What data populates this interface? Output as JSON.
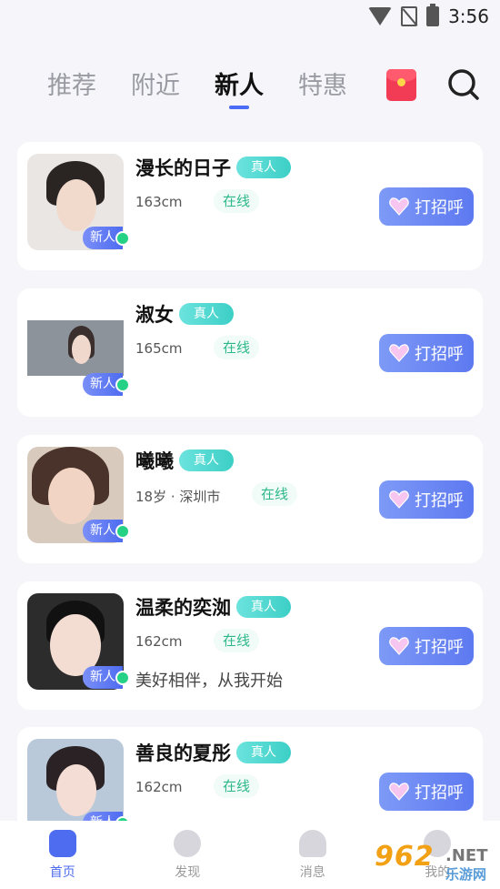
{
  "status_bar": {
    "time": "3:56"
  },
  "top_tabs": [
    {
      "label": "推荐"
    },
    {
      "label": "附近"
    },
    {
      "label": "新人",
      "active": true
    },
    {
      "label": "特惠"
    }
  ],
  "icons": {
    "red_packet": "red-packet-icon",
    "search": "search-icon"
  },
  "colors": {
    "accent": "#4e6cf0",
    "real_badge": "#3ccfc6",
    "online": "#25d184",
    "red_packet": "#f23c56"
  },
  "users": [
    {
      "name": "漫长的日子",
      "real_badge": "真人",
      "info": "163cm",
      "online": "在线",
      "new_badge": "新人",
      "bio": "",
      "greet": "打招呼"
    },
    {
      "name": "淑女",
      "real_badge": "真人",
      "info": "165cm",
      "online": "在线",
      "new_badge": "新人",
      "bio": "",
      "greet": "打招呼"
    },
    {
      "name": "曦曦",
      "real_badge": "真人",
      "info": "18岁 · 深圳市",
      "online": "在线",
      "new_badge": "新人",
      "bio": "",
      "greet": "打招呼"
    },
    {
      "name": "温柔的奕洳",
      "real_badge": "真人",
      "info": "162cm",
      "online": "在线",
      "new_badge": "新人",
      "bio": "美好相伴，从我开始",
      "greet": "打招呼"
    },
    {
      "name": "善良的夏彤",
      "real_badge": "真人",
      "info": "162cm",
      "online": "在线",
      "new_badge": "新人",
      "bio": "",
      "greet": "打招呼"
    }
  ],
  "bottom_nav": [
    {
      "label": "首页",
      "active": true
    },
    {
      "label": "发现"
    },
    {
      "label": "消息"
    },
    {
      "label": "我的"
    }
  ],
  "watermark": {
    "number": "962",
    "suffix": ".NET",
    "text": "乐游网"
  }
}
